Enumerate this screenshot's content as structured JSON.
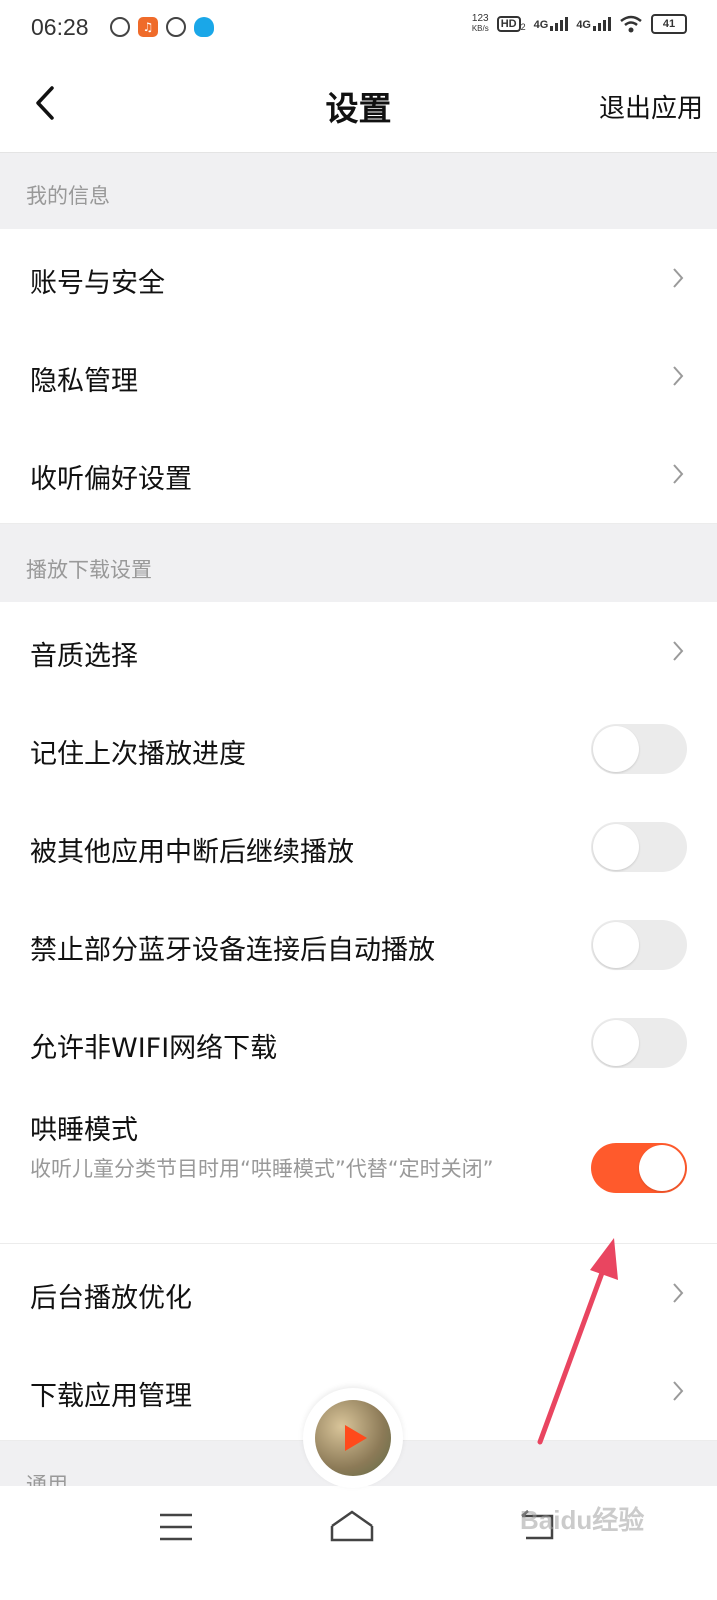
{
  "status": {
    "time": "06:28",
    "speed_top": "123",
    "speed_unit": "KB/s",
    "hd": "HD",
    "hd_sub": "2",
    "net1": "4G",
    "net2": "4G",
    "battery": "41"
  },
  "nav": {
    "title": "设置",
    "exit_label": "退出应用"
  },
  "sections": {
    "my_info": "我的信息",
    "playback": "播放下载设置",
    "general": "通用"
  },
  "rows": {
    "account": "账号与安全",
    "privacy": "隐私管理",
    "listening_pref": "收听偏好设置",
    "audio_quality": "音质选择",
    "remember_progress": "记住上次播放进度",
    "resume_after_interrupt": "被其他应用中断后继续播放",
    "block_bluetooth": "禁止部分蓝牙设备连接后自动播放",
    "allow_non_wifi": "允许非WIFI网络下载",
    "sleep_mode": "哄睡模式",
    "sleep_mode_desc": "收听儿童分类节目时用“哄睡模式”代替“定时关闭”",
    "background_opt": "后台播放优化",
    "download_manager": "下载应用管理"
  },
  "toggles": {
    "remember_progress": false,
    "resume_after_interrupt": false,
    "block_bluetooth": false,
    "allow_non_wifi": false,
    "sleep_mode": true
  },
  "colors": {
    "accent": "#ff5a2c",
    "arrow": "#e94560"
  },
  "watermark": "Baidu经验"
}
